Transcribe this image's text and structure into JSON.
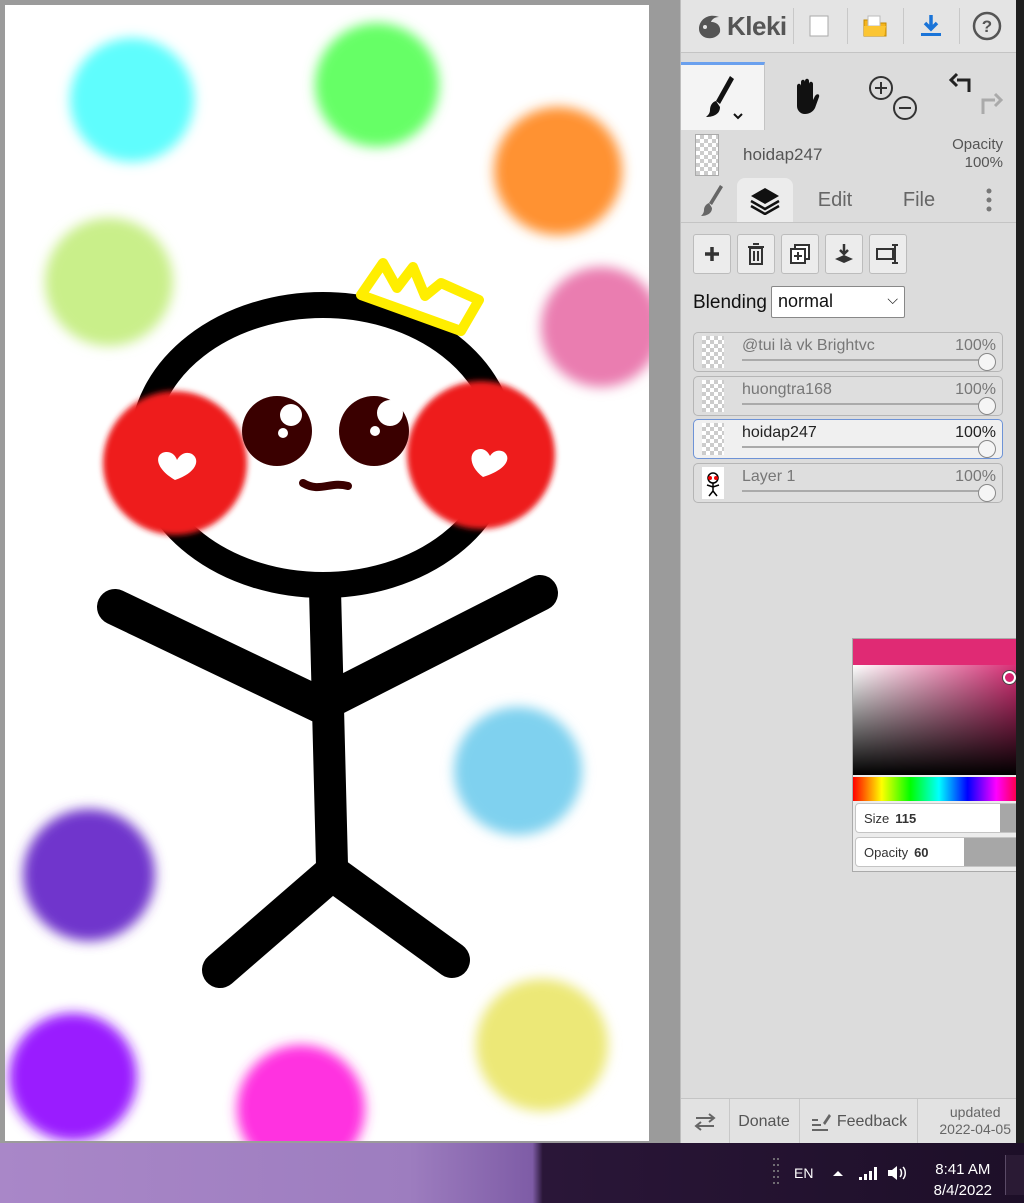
{
  "app": {
    "brand": "Kleki"
  },
  "toolbar": {
    "new_icon": "new-file-icon",
    "open_icon": "open-folder-icon",
    "save_icon": "download-icon",
    "help_icon": "help-icon"
  },
  "current_layer": {
    "name": "hoidap247",
    "opacity_label": "Opacity",
    "opacity_value": "100%"
  },
  "tabs": [
    {
      "label": "",
      "icon": "brush-icon"
    },
    {
      "label": "",
      "icon": "layers-icon"
    },
    {
      "label": "Edit"
    },
    {
      "label": "File"
    }
  ],
  "blending": {
    "label": "Blending",
    "value": "normal"
  },
  "layers": [
    {
      "name": "@tui là vk Brightvc",
      "opacity": "100%",
      "active": false
    },
    {
      "name": "huongtra168",
      "opacity": "100%",
      "active": false
    },
    {
      "name": "hoidap247",
      "opacity": "100%",
      "active": true
    },
    {
      "name": "Layer 1",
      "opacity": "100%",
      "active": false
    }
  ],
  "color_picker": {
    "color": "#e02a74",
    "size_label": "Size",
    "size_value": "115",
    "opacity_label": "Opacity",
    "opacity_value": "60"
  },
  "bottom": {
    "donate": "Donate",
    "feedback": "Feedback",
    "updated_label": "updated",
    "updated_date": "2022-04-05"
  },
  "taskbar": {
    "language": "EN",
    "time": "8:41 AM",
    "date": "8/4/2022"
  }
}
